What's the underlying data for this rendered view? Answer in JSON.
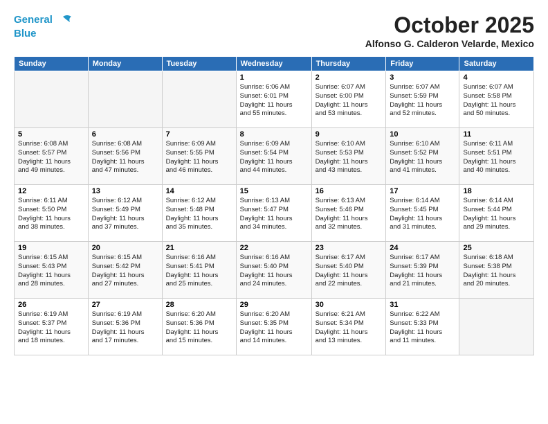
{
  "header": {
    "logo_line1": "General",
    "logo_line2": "Blue",
    "month": "October 2025",
    "location": "Alfonso G. Calderon Velarde, Mexico"
  },
  "weekdays": [
    "Sunday",
    "Monday",
    "Tuesday",
    "Wednesday",
    "Thursday",
    "Friday",
    "Saturday"
  ],
  "weeks": [
    [
      {
        "day": "",
        "info": ""
      },
      {
        "day": "",
        "info": ""
      },
      {
        "day": "",
        "info": ""
      },
      {
        "day": "1",
        "info": "Sunrise: 6:06 AM\nSunset: 6:01 PM\nDaylight: 11 hours\nand 55 minutes."
      },
      {
        "day": "2",
        "info": "Sunrise: 6:07 AM\nSunset: 6:00 PM\nDaylight: 11 hours\nand 53 minutes."
      },
      {
        "day": "3",
        "info": "Sunrise: 6:07 AM\nSunset: 5:59 PM\nDaylight: 11 hours\nand 52 minutes."
      },
      {
        "day": "4",
        "info": "Sunrise: 6:07 AM\nSunset: 5:58 PM\nDaylight: 11 hours\nand 50 minutes."
      }
    ],
    [
      {
        "day": "5",
        "info": "Sunrise: 6:08 AM\nSunset: 5:57 PM\nDaylight: 11 hours\nand 49 minutes."
      },
      {
        "day": "6",
        "info": "Sunrise: 6:08 AM\nSunset: 5:56 PM\nDaylight: 11 hours\nand 47 minutes."
      },
      {
        "day": "7",
        "info": "Sunrise: 6:09 AM\nSunset: 5:55 PM\nDaylight: 11 hours\nand 46 minutes."
      },
      {
        "day": "8",
        "info": "Sunrise: 6:09 AM\nSunset: 5:54 PM\nDaylight: 11 hours\nand 44 minutes."
      },
      {
        "day": "9",
        "info": "Sunrise: 6:10 AM\nSunset: 5:53 PM\nDaylight: 11 hours\nand 43 minutes."
      },
      {
        "day": "10",
        "info": "Sunrise: 6:10 AM\nSunset: 5:52 PM\nDaylight: 11 hours\nand 41 minutes."
      },
      {
        "day": "11",
        "info": "Sunrise: 6:11 AM\nSunset: 5:51 PM\nDaylight: 11 hours\nand 40 minutes."
      }
    ],
    [
      {
        "day": "12",
        "info": "Sunrise: 6:11 AM\nSunset: 5:50 PM\nDaylight: 11 hours\nand 38 minutes."
      },
      {
        "day": "13",
        "info": "Sunrise: 6:12 AM\nSunset: 5:49 PM\nDaylight: 11 hours\nand 37 minutes."
      },
      {
        "day": "14",
        "info": "Sunrise: 6:12 AM\nSunset: 5:48 PM\nDaylight: 11 hours\nand 35 minutes."
      },
      {
        "day": "15",
        "info": "Sunrise: 6:13 AM\nSunset: 5:47 PM\nDaylight: 11 hours\nand 34 minutes."
      },
      {
        "day": "16",
        "info": "Sunrise: 6:13 AM\nSunset: 5:46 PM\nDaylight: 11 hours\nand 32 minutes."
      },
      {
        "day": "17",
        "info": "Sunrise: 6:14 AM\nSunset: 5:45 PM\nDaylight: 11 hours\nand 31 minutes."
      },
      {
        "day": "18",
        "info": "Sunrise: 6:14 AM\nSunset: 5:44 PM\nDaylight: 11 hours\nand 29 minutes."
      }
    ],
    [
      {
        "day": "19",
        "info": "Sunrise: 6:15 AM\nSunset: 5:43 PM\nDaylight: 11 hours\nand 28 minutes."
      },
      {
        "day": "20",
        "info": "Sunrise: 6:15 AM\nSunset: 5:42 PM\nDaylight: 11 hours\nand 27 minutes."
      },
      {
        "day": "21",
        "info": "Sunrise: 6:16 AM\nSunset: 5:41 PM\nDaylight: 11 hours\nand 25 minutes."
      },
      {
        "day": "22",
        "info": "Sunrise: 6:16 AM\nSunset: 5:40 PM\nDaylight: 11 hours\nand 24 minutes."
      },
      {
        "day": "23",
        "info": "Sunrise: 6:17 AM\nSunset: 5:40 PM\nDaylight: 11 hours\nand 22 minutes."
      },
      {
        "day": "24",
        "info": "Sunrise: 6:17 AM\nSunset: 5:39 PM\nDaylight: 11 hours\nand 21 minutes."
      },
      {
        "day": "25",
        "info": "Sunrise: 6:18 AM\nSunset: 5:38 PM\nDaylight: 11 hours\nand 20 minutes."
      }
    ],
    [
      {
        "day": "26",
        "info": "Sunrise: 6:19 AM\nSunset: 5:37 PM\nDaylight: 11 hours\nand 18 minutes."
      },
      {
        "day": "27",
        "info": "Sunrise: 6:19 AM\nSunset: 5:36 PM\nDaylight: 11 hours\nand 17 minutes."
      },
      {
        "day": "28",
        "info": "Sunrise: 6:20 AM\nSunset: 5:36 PM\nDaylight: 11 hours\nand 15 minutes."
      },
      {
        "day": "29",
        "info": "Sunrise: 6:20 AM\nSunset: 5:35 PM\nDaylight: 11 hours\nand 14 minutes."
      },
      {
        "day": "30",
        "info": "Sunrise: 6:21 AM\nSunset: 5:34 PM\nDaylight: 11 hours\nand 13 minutes."
      },
      {
        "day": "31",
        "info": "Sunrise: 6:22 AM\nSunset: 5:33 PM\nDaylight: 11 hours\nand 11 minutes."
      },
      {
        "day": "",
        "info": ""
      }
    ]
  ]
}
